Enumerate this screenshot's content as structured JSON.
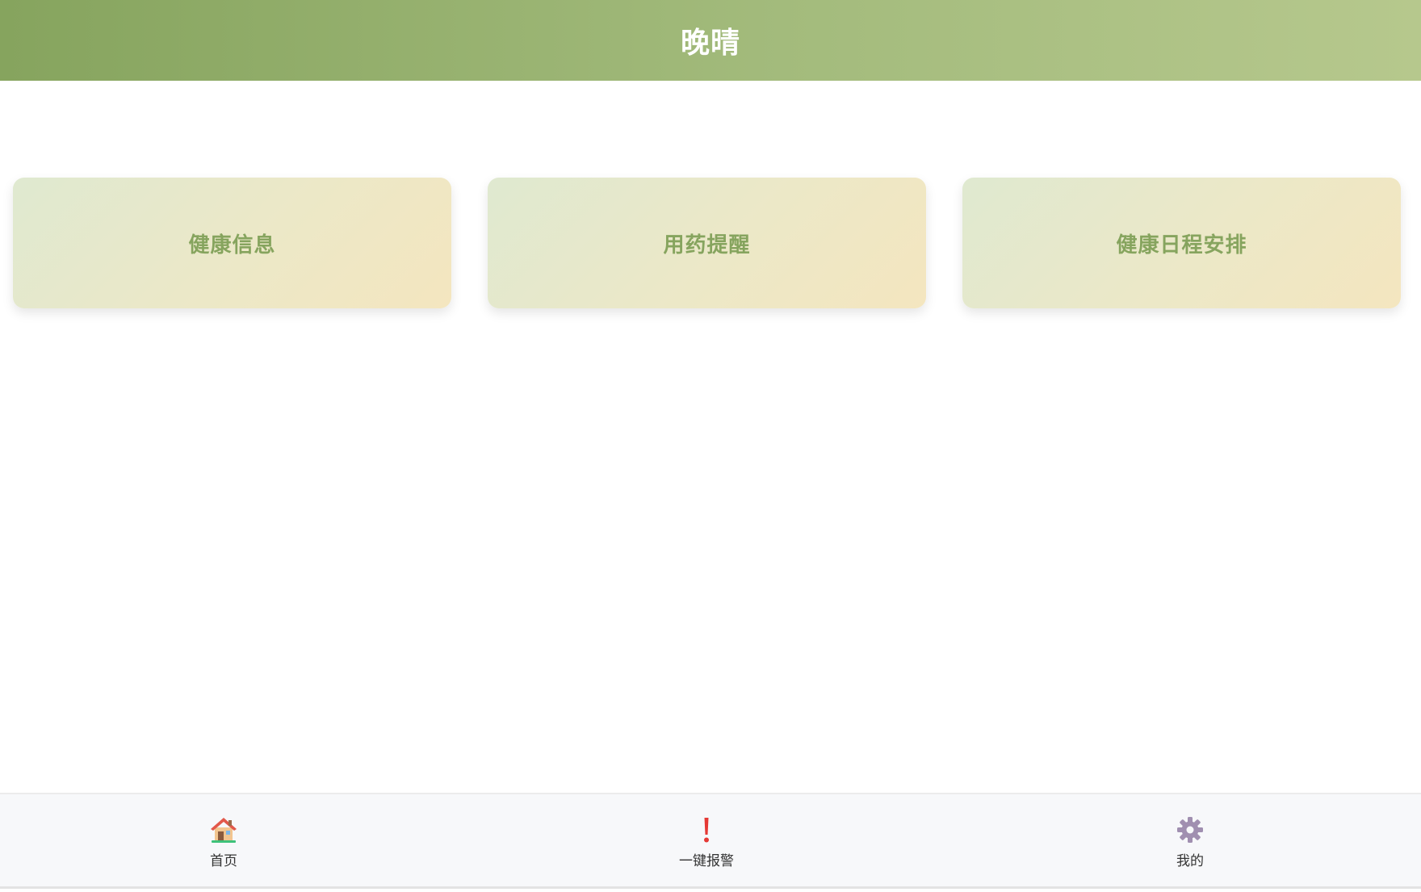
{
  "header": {
    "title": "晚晴"
  },
  "cards": [
    {
      "label": "健康信息"
    },
    {
      "label": "用药提醒"
    },
    {
      "label": "健康日程安排"
    }
  ],
  "bottom_nav": {
    "items": [
      {
        "label": "首页",
        "icon": "house-icon"
      },
      {
        "label": "一键报警",
        "icon": "exclamation-icon"
      },
      {
        "label": "我的",
        "icon": "gear-icon"
      }
    ]
  },
  "colors": {
    "header_gradient_start": "#86a45e",
    "header_gradient_end": "#b6c88d",
    "card_text": "#86a45e",
    "card_gradient_start": "#dfe9d0",
    "card_gradient_end": "#f4e6bf",
    "alarm_red": "#e53935",
    "gear_purple": "#a08fb0"
  }
}
